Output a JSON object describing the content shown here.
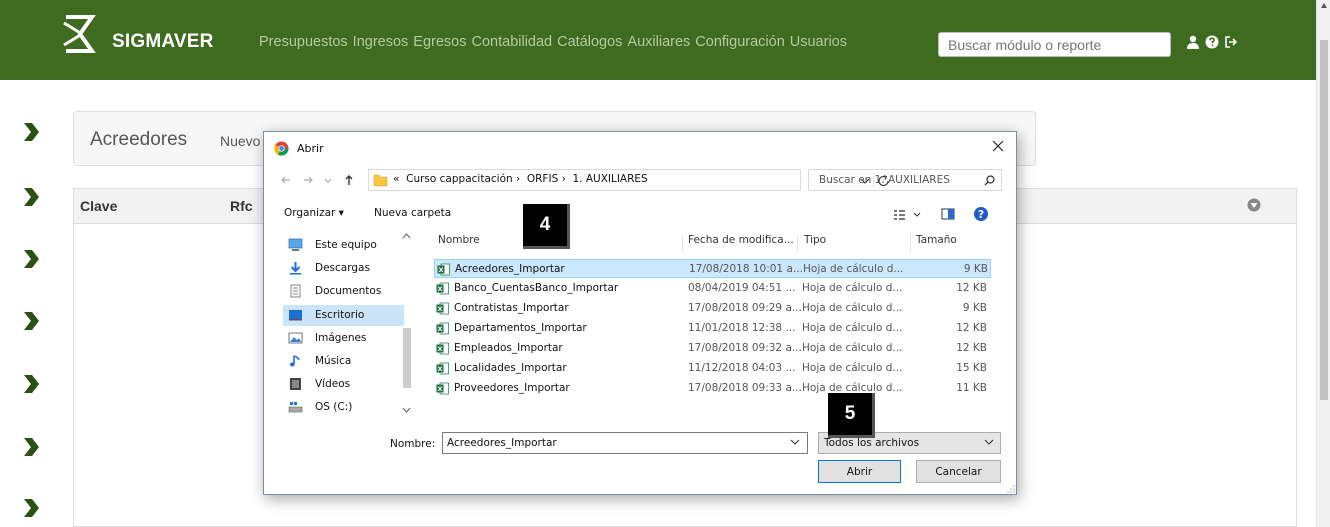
{
  "navbar": {
    "brand": "SIGMAVER",
    "menu": [
      "Presupuestos",
      "Ingresos",
      "Egresos",
      "Contabilidad",
      "Catálogos",
      "Auxiliares",
      "Configuración",
      "Usuarios"
    ],
    "search_placeholder": "Buscar módulo o reporte",
    "icons": [
      "user-icon",
      "help-icon",
      "logout-icon"
    ],
    "bg_color": "#3f6b20"
  },
  "page": {
    "title": "Acreedores",
    "new_link": "Nuevo",
    "table_headers": [
      "Clave",
      "Rfc"
    ]
  },
  "dialog": {
    "title": "Abrir",
    "breadcrumb_prefix": "«",
    "breadcrumbs": [
      "Curso cappacitación",
      "ORFIS",
      "1. AUXILIARES"
    ],
    "search_placeholder": "Buscar en 1. AUXILIARES",
    "toolbar": {
      "organize": "Organizar ▾",
      "new_folder": "Nueva carpeta"
    },
    "nav_items": [
      {
        "label": "Este equipo",
        "icon": "computer-icon"
      },
      {
        "label": "Descargas",
        "icon": "download-icon"
      },
      {
        "label": "Documentos",
        "icon": "document-icon"
      },
      {
        "label": "Escritorio",
        "icon": "desktop-icon",
        "selected": true
      },
      {
        "label": "Imágenes",
        "icon": "image-icon"
      },
      {
        "label": "Música",
        "icon": "music-icon"
      },
      {
        "label": "Vídeos",
        "icon": "video-icon"
      },
      {
        "label": "OS (C:)",
        "icon": "drive-icon"
      }
    ],
    "columns": {
      "name": "Nombre",
      "date": "Fecha de modifica...",
      "type": "Tipo",
      "size": "Tamaño"
    },
    "files": [
      {
        "name": "Acreedores_Importar",
        "date": "17/08/2018 10:01 a...",
        "type": "Hoja de cálculo d...",
        "size": "9 KB",
        "selected": true
      },
      {
        "name": "Banco_CuentasBanco_Importar",
        "date": "08/04/2019 04:51 ...",
        "type": "Hoja de cálculo d...",
        "size": "12 KB"
      },
      {
        "name": "Contratistas_Importar",
        "date": "17/08/2018 09:29 a...",
        "type": "Hoja de cálculo d...",
        "size": "9 KB"
      },
      {
        "name": "Departamentos_Importar",
        "date": "11/01/2018 12:38 ...",
        "type": "Hoja de cálculo d...",
        "size": "12 KB"
      },
      {
        "name": "Empleados_Importar",
        "date": "17/08/2018 09:32 a...",
        "type": "Hoja de cálculo d...",
        "size": "12 KB"
      },
      {
        "name": "Localidades_Importar",
        "date": "11/12/2018 04:03 ...",
        "type": "Hoja de cálculo d...",
        "size": "15 KB"
      },
      {
        "name": "Proveedores_Importar",
        "date": "17/08/2018 09:33 a...",
        "type": "Hoja de cálculo d...",
        "size": "11 KB"
      }
    ],
    "name_label": "Nombre:",
    "name_value": "Acreedores_Importar",
    "filter_value": "Todos los archivos",
    "open_button": "Abrir",
    "cancel_button": "Cancelar"
  },
  "callouts": [
    "4",
    "5"
  ]
}
